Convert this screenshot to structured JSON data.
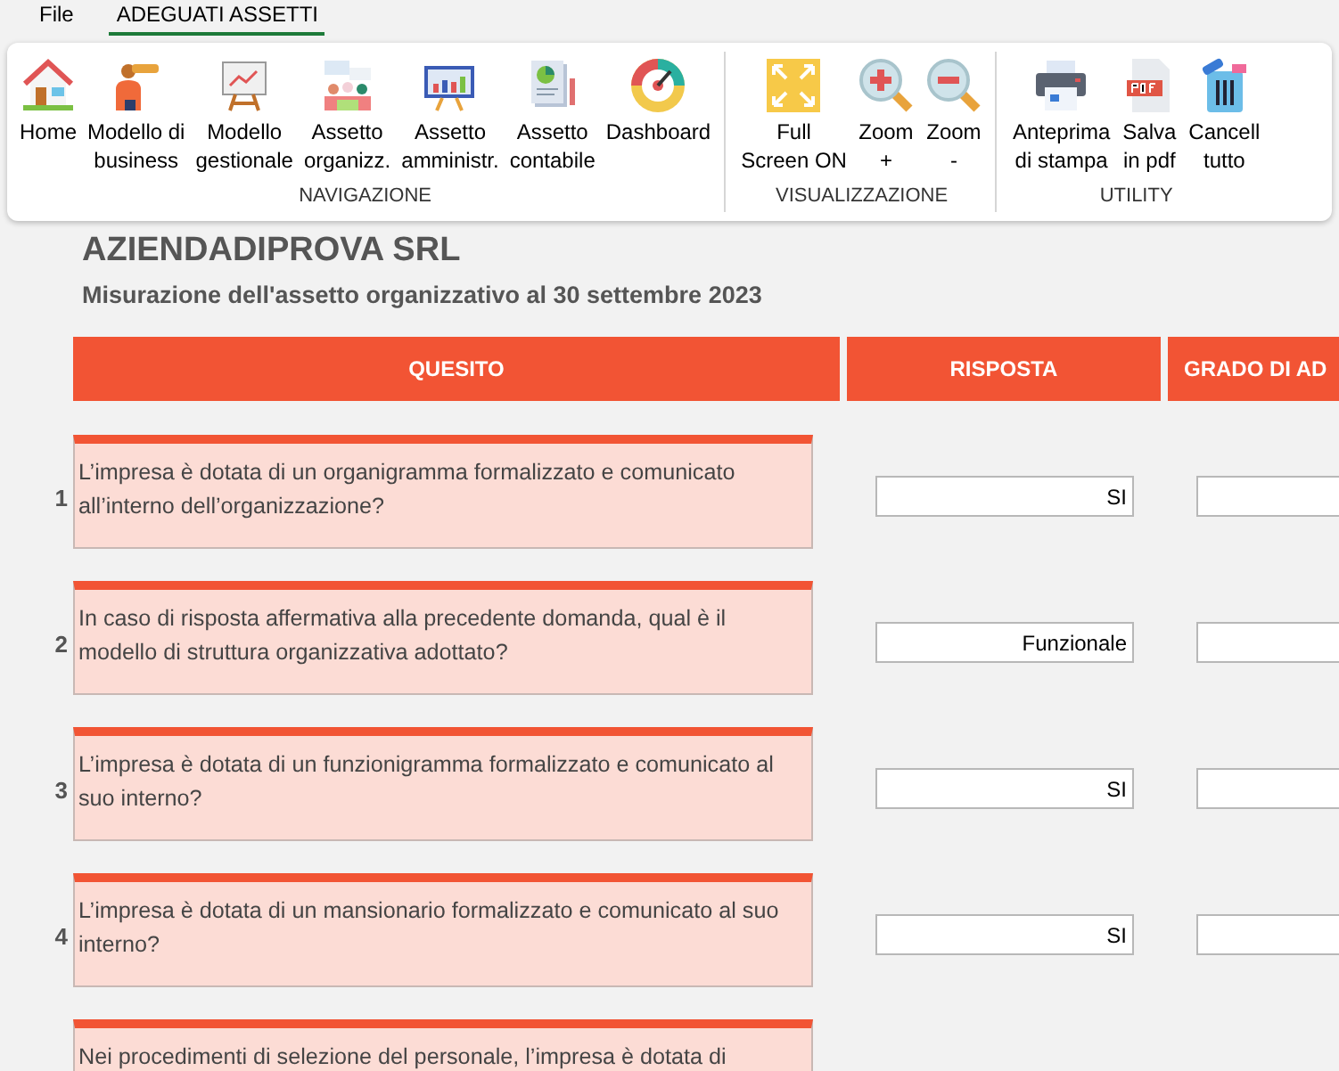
{
  "menu_tabs": [
    {
      "label": "File",
      "selected": false
    },
    {
      "label": "ADEGUATI ASSETTI",
      "selected": true
    }
  ],
  "ribbon_groups": [
    {
      "label": "NAVIGAZIONE",
      "buttons": [
        {
          "lines": [
            "Home"
          ]
        },
        {
          "lines": [
            "Modello di",
            "business"
          ]
        },
        {
          "lines": [
            "Modello",
            "gestionale"
          ]
        },
        {
          "lines": [
            "Assetto",
            "organizz."
          ]
        },
        {
          "lines": [
            "Assetto",
            "amministr."
          ]
        },
        {
          "lines": [
            "Assetto",
            "contabile"
          ]
        },
        {
          "lines": [
            "Dashboard"
          ]
        }
      ]
    },
    {
      "label": "VISUALIZZAZIONE",
      "buttons": [
        {
          "lines": [
            "Full",
            "Screen ON"
          ]
        },
        {
          "lines": [
            "Zoom",
            "+"
          ]
        },
        {
          "lines": [
            "Zoom",
            "-"
          ]
        }
      ]
    },
    {
      "label": "UTILITY",
      "buttons": [
        {
          "lines": [
            "Anteprima",
            "di stampa"
          ]
        },
        {
          "lines": [
            "Salva",
            "in pdf"
          ]
        },
        {
          "lines": [
            "Cancell",
            "tutto"
          ]
        }
      ]
    }
  ],
  "company": "AZIENDADIPROVA SRL",
  "subtitle": "Misurazione dell'assetto organizzativo al 30 settembre 2023",
  "table": {
    "columns": [
      "QUESITO",
      "RISPOSTA",
      "GRADO DI AD"
    ],
    "rows": [
      {
        "number": "1",
        "question": "L’impresa è dotata di un organigramma formalizzato e comunicato all’interno dell’organizzazione?",
        "answer": "SI"
      },
      {
        "number": "2",
        "question": "In caso di risposta affermativa alla precedente domanda, qual è il modello di struttura organizzativa adottato?",
        "answer": "Funzionale"
      },
      {
        "number": "3",
        "question": "L’impresa è dotata di un funzionigramma formalizzato e comunicato al suo interno?",
        "answer": "SI"
      },
      {
        "number": "4",
        "question": "L’impresa è dotata di un mansionario formalizzato e comunicato al suo interno?",
        "answer": "SI"
      },
      {
        "question": "Nei procedimenti di selezione del personale, l’impresa è dotata di"
      }
    ]
  }
}
